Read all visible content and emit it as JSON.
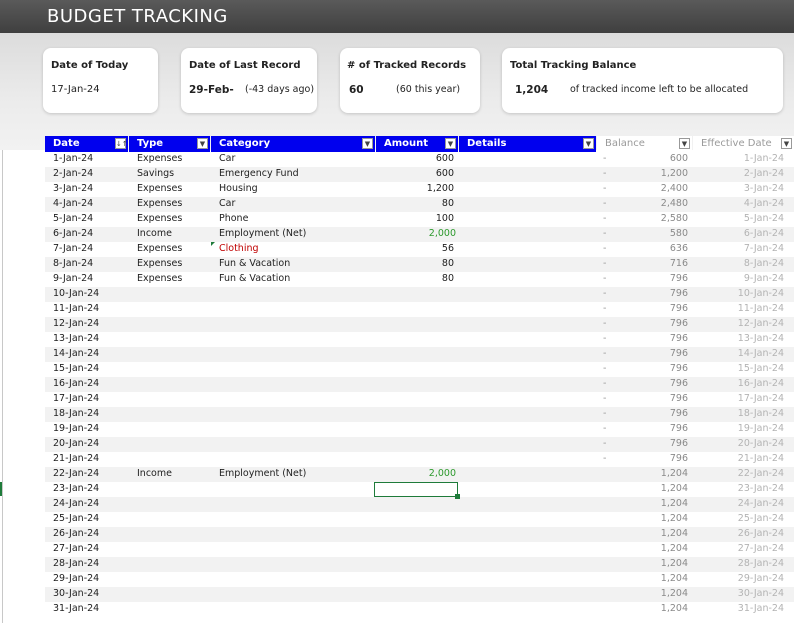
{
  "title": "BUDGET TRACKING",
  "cards": {
    "today": {
      "label": "Date of Today",
      "value": "17-Jan-24"
    },
    "last_record": {
      "label": "Date of Last Record",
      "value": "29-Feb-",
      "sub": "(-43 days ago)"
    },
    "tracked": {
      "label": "# of Tracked Records",
      "value": "60",
      "sub": "(60 this year)"
    },
    "balance": {
      "label": "Total Tracking Balance",
      "value": "1,204",
      "sub": "of tracked income left to be allocated"
    }
  },
  "columns": {
    "date": "Date",
    "date_filter_icon": "↓↑",
    "type": "Type",
    "category": "Category",
    "amount": "Amount",
    "details": "Details",
    "balance": "Balance",
    "effective_date": "Effective Date",
    "dropdown_glyph": "▼"
  },
  "colors": {
    "header_blue": "#0000ee",
    "income_green": "#2e9a2e",
    "category_red": "#c00000",
    "selection_green": "#1e7b3a"
  },
  "rows": [
    {
      "date": "1-Jan-24",
      "type": "Expenses",
      "category": "Car",
      "amount": "600",
      "dash": "-",
      "balance": "600",
      "eff": "1-Jan-24"
    },
    {
      "date": "2-Jan-24",
      "type": "Savings",
      "category": "Emergency Fund",
      "amount": "600",
      "dash": "-",
      "balance": "1,200",
      "eff": "2-Jan-24"
    },
    {
      "date": "3-Jan-24",
      "type": "Expenses",
      "category": "Housing",
      "amount": "1,200",
      "dash": "-",
      "balance": "2,400",
      "eff": "3-Jan-24"
    },
    {
      "date": "4-Jan-24",
      "type": "Expenses",
      "category": "Car",
      "amount": "80",
      "dash": "-",
      "balance": "2,480",
      "eff": "4-Jan-24"
    },
    {
      "date": "5-Jan-24",
      "type": "Expenses",
      "category": "Phone",
      "amount": "100",
      "dash": "-",
      "balance": "2,580",
      "eff": "5-Jan-24"
    },
    {
      "date": "6-Jan-24",
      "type": "Income",
      "category": "Employment (Net)",
      "income": "2,000",
      "dash": "-",
      "balance": "580",
      "eff": "6-Jan-24"
    },
    {
      "date": "7-Jan-24",
      "type": "Expenses",
      "category": "Clothing",
      "amount": "56",
      "dash": "-",
      "balance": "636",
      "eff": "7-Jan-24",
      "red": true
    },
    {
      "date": "8-Jan-24",
      "type": "Expenses",
      "category": "Fun & Vacation",
      "amount": "80",
      "dash": "-",
      "balance": "716",
      "eff": "8-Jan-24"
    },
    {
      "date": "9-Jan-24",
      "type": "Expenses",
      "category": "Fun & Vacation",
      "amount": "80",
      "dash": "-",
      "balance": "796",
      "eff": "9-Jan-24"
    },
    {
      "date": "10-Jan-24",
      "dash": "-",
      "balance": "796",
      "eff": "10-Jan-24"
    },
    {
      "date": "11-Jan-24",
      "dash": "-",
      "balance": "796",
      "eff": "11-Jan-24"
    },
    {
      "date": "12-Jan-24",
      "dash": "-",
      "balance": "796",
      "eff": "12-Jan-24"
    },
    {
      "date": "13-Jan-24",
      "dash": "-",
      "balance": "796",
      "eff": "13-Jan-24"
    },
    {
      "date": "14-Jan-24",
      "dash": "-",
      "balance": "796",
      "eff": "14-Jan-24"
    },
    {
      "date": "15-Jan-24",
      "dash": "-",
      "balance": "796",
      "eff": "15-Jan-24"
    },
    {
      "date": "16-Jan-24",
      "dash": "-",
      "balance": "796",
      "eff": "16-Jan-24"
    },
    {
      "date": "17-Jan-24",
      "dash": "-",
      "balance": "796",
      "eff": "17-Jan-24"
    },
    {
      "date": "18-Jan-24",
      "dash": "-",
      "balance": "796",
      "eff": "18-Jan-24"
    },
    {
      "date": "19-Jan-24",
      "dash": "-",
      "balance": "796",
      "eff": "19-Jan-24"
    },
    {
      "date": "20-Jan-24",
      "dash": "-",
      "balance": "796",
      "eff": "20-Jan-24"
    },
    {
      "date": "21-Jan-24",
      "dash": "-",
      "balance": "796",
      "eff": "21-Jan-24"
    },
    {
      "date": "22-Jan-24",
      "type": "Income",
      "category": "Employment (Net)",
      "income": "2,000",
      "balance": "1,204",
      "eff": "22-Jan-24"
    },
    {
      "date": "23-Jan-24",
      "balance": "1,204",
      "eff": "23-Jan-24"
    },
    {
      "date": "24-Jan-24",
      "balance": "1,204",
      "eff": "24-Jan-24"
    },
    {
      "date": "25-Jan-24",
      "balance": "1,204",
      "eff": "25-Jan-24"
    },
    {
      "date": "26-Jan-24",
      "balance": "1,204",
      "eff": "26-Jan-24"
    },
    {
      "date": "27-Jan-24",
      "balance": "1,204",
      "eff": "27-Jan-24"
    },
    {
      "date": "28-Jan-24",
      "balance": "1,204",
      "eff": "28-Jan-24"
    },
    {
      "date": "29-Jan-24",
      "balance": "1,204",
      "eff": "29-Jan-24"
    },
    {
      "date": "30-Jan-24",
      "balance": "1,204",
      "eff": "30-Jan-24"
    },
    {
      "date": "31-Jan-24",
      "balance": "1,204",
      "eff": "31-Jan-24"
    }
  ]
}
